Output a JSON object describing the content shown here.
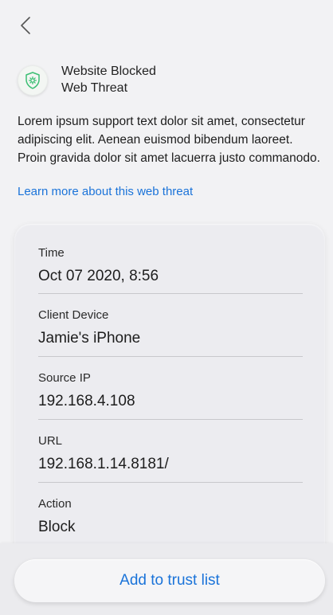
{
  "header": {
    "title": "Website Blocked",
    "subtitle": "Web Threat",
    "icon": "shield-gear-icon"
  },
  "description": "Lorem ipsum support text dolor sit amet, consectetur adipiscing elit. Aenean euismod bibendum laoreet. Proin gravida dolor sit amet lacuerra justo commanodo.",
  "learn_more_link": "Learn more about this web threat",
  "details": [
    {
      "label": "Time",
      "value": "Oct 07 2020, 8:56"
    },
    {
      "label": "Client Device",
      "value": "Jamie's iPhone"
    },
    {
      "label": "Source IP",
      "value": "192.168.4.108"
    },
    {
      "label": "URL",
      "value": "192.168.1.14.8181/"
    },
    {
      "label": "Action",
      "value": "Block"
    }
  ],
  "footer": {
    "button_label": "Add to trust list"
  },
  "colors": {
    "accent": "#1a73d9",
    "shield": "#3cbf74",
    "background": "#f2f2f4"
  }
}
